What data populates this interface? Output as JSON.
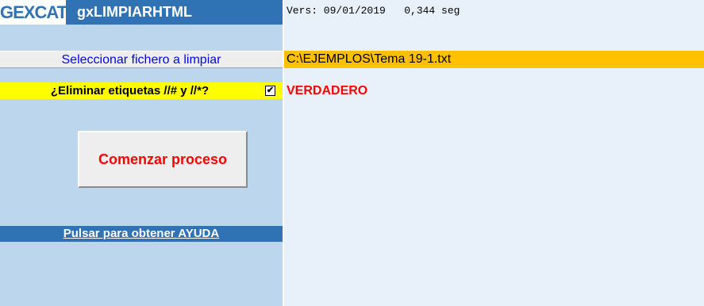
{
  "header": {
    "logo_text": "GEXCAT",
    "app_title": "gxLIMPIARHTML",
    "version_text": "Vers: 09/01/2019   0,344 seg"
  },
  "file": {
    "select_label": "Seleccionar fichero a limpiar",
    "path_value": "C:\\EJEMPLOS\\Tema 19-1.txt"
  },
  "option": {
    "label": "¿Eliminar etiquetas //# y //*?",
    "checked_mark": "✔",
    "value_text": "VERDADERO"
  },
  "actions": {
    "start_label": "Comenzar proceso",
    "help_label": "Pulsar para obtener AYUDA"
  },
  "colors": {
    "panel_bg": "#bcd6ee",
    "content_bg": "#e8f0f9",
    "header_blue": "#2f73b5",
    "path_bg": "#ffc000",
    "option_bg": "#ffff00",
    "alert_red": "#ff0000"
  }
}
